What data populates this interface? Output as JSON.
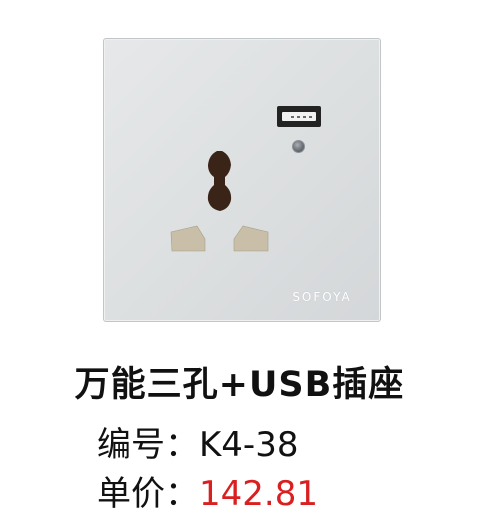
{
  "product": {
    "brand": "SOFOYA",
    "name": "万能三孔+USB插座"
  },
  "details": {
    "code_label": "编号：",
    "code_value": "K4-38",
    "price_label": "单价：",
    "price_value": "142.81"
  },
  "colors": {
    "panel": "#dcdfe0",
    "price": "#d91f1f",
    "text": "#111111"
  }
}
